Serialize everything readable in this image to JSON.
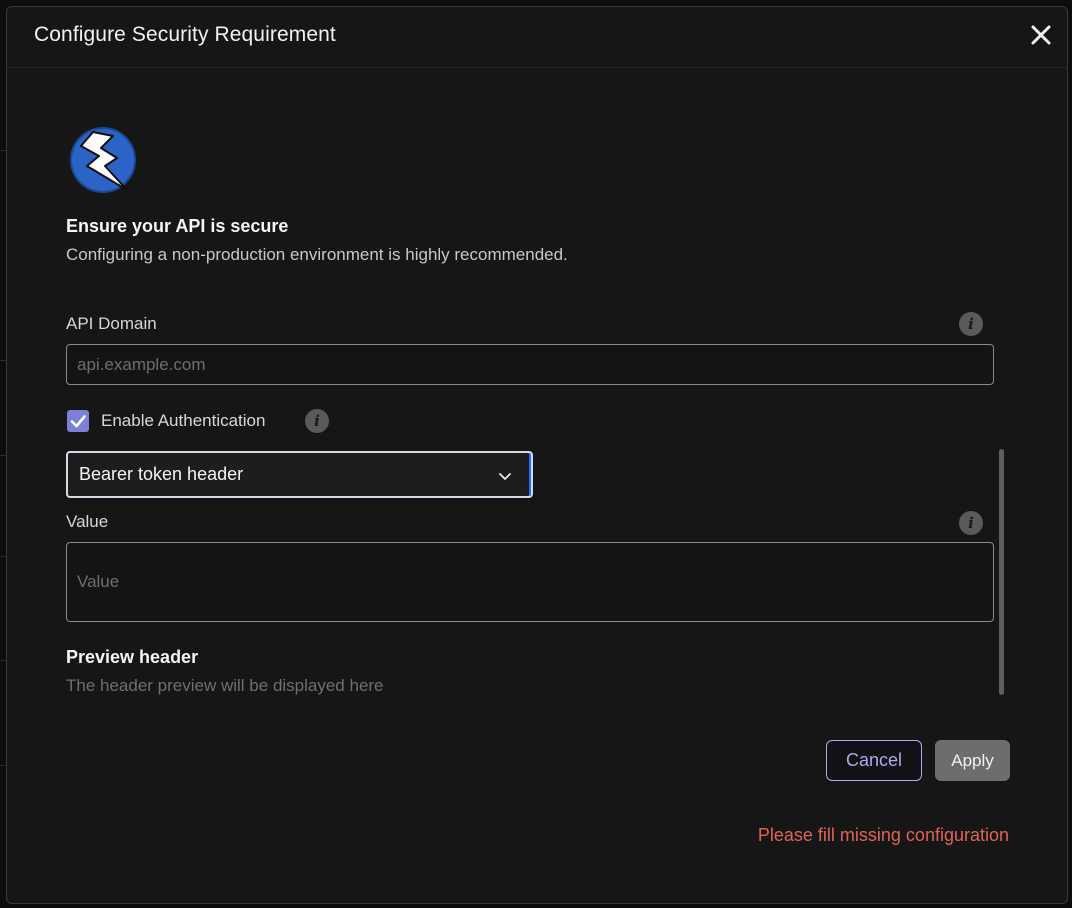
{
  "dialog": {
    "title": "Configure Security Requirement",
    "close_icon": "close-icon"
  },
  "intro": {
    "logo_icon": "lightning-bolt-logo",
    "headline": "Ensure your API is secure",
    "subline": "Configuring a non-production environment is highly recommended."
  },
  "api_domain": {
    "label": "API Domain",
    "value": "",
    "placeholder": "api.example.com",
    "info_icon": "info-icon"
  },
  "auth": {
    "checkbox_label": "Enable Authentication",
    "checked": true,
    "info_icon": "info-icon",
    "method_selected": "Bearer token header"
  },
  "value_field": {
    "label": "Value",
    "value": "",
    "placeholder": "Value",
    "info_icon": "info-icon"
  },
  "preview": {
    "title": "Preview header",
    "text": "The header preview will be displayed here"
  },
  "actions": {
    "cancel_label": "Cancel",
    "apply_label": "Apply"
  },
  "status": {
    "error": "Please fill missing configuration"
  },
  "colors": {
    "accent": "#a9acef",
    "checkbox": "#7d7fd8",
    "focus_ring": "#1e6fff",
    "error": "#e06355",
    "dialog_bg": "#161616"
  }
}
